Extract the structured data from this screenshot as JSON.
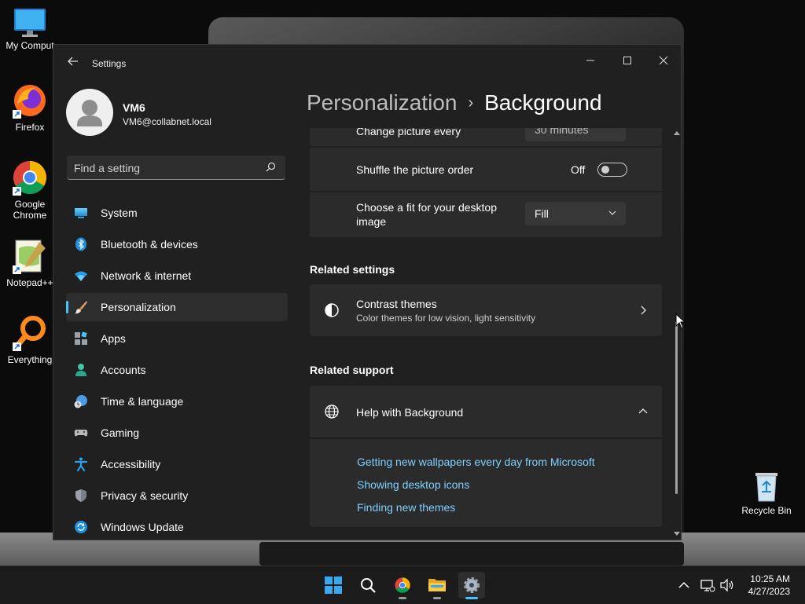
{
  "desktop": {
    "icons": [
      {
        "label": "My Comput"
      },
      {
        "label": "Firefox"
      },
      {
        "label": "Google Chrome"
      },
      {
        "label": "Notepad++"
      },
      {
        "label": "Everything"
      },
      {
        "label": "Recycle Bin"
      }
    ]
  },
  "window": {
    "title": "Settings",
    "back_icon": "arrow-left-icon",
    "controls": [
      "minimize-icon",
      "maximize-icon",
      "close-icon"
    ]
  },
  "profile": {
    "name": "VM6",
    "email": "VM6@collabnet.local"
  },
  "search": {
    "placeholder": "Find a setting"
  },
  "nav": {
    "items": [
      {
        "label": "System",
        "icon": "monitor-icon",
        "active": false
      },
      {
        "label": "Bluetooth & devices",
        "icon": "bluetooth-icon",
        "active": false
      },
      {
        "label": "Network & internet",
        "icon": "wifi-icon",
        "active": false
      },
      {
        "label": "Personalization",
        "icon": "brush-icon",
        "active": true
      },
      {
        "label": "Apps",
        "icon": "apps-icon",
        "active": false
      },
      {
        "label": "Accounts",
        "icon": "person-icon",
        "active": false
      },
      {
        "label": "Time & language",
        "icon": "globe-clock-icon",
        "active": false
      },
      {
        "label": "Gaming",
        "icon": "gamepad-icon",
        "active": false
      },
      {
        "label": "Accessibility",
        "icon": "accessibility-icon",
        "active": false
      },
      {
        "label": "Privacy & security",
        "icon": "shield-icon",
        "active": false
      },
      {
        "label": "Windows Update",
        "icon": "update-icon",
        "active": false
      }
    ]
  },
  "header": {
    "parent": "Personalization",
    "separator": "›",
    "current": "Background"
  },
  "background": {
    "change_picture_label": "Change picture every",
    "change_picture_value": "30 minutes",
    "shuffle_label": "Shuffle the picture order",
    "shuffle_state": "Off",
    "fit_label_line1": "Choose a fit for your desktop",
    "fit_label_line2": "image",
    "fit_value": "Fill"
  },
  "related_settings": {
    "heading": "Related settings",
    "items": [
      {
        "title": "Contrast themes",
        "subtitle": "Color themes for low vision, light sensitivity"
      }
    ]
  },
  "related_support": {
    "heading": "Related support",
    "help_title": "Help with Background",
    "links": [
      "Getting new wallpapers every day from Microsoft",
      "Showing desktop icons",
      "Finding new themes"
    ]
  },
  "taskbar": {
    "apps": [
      "start-icon",
      "search-icon",
      "chrome-icon",
      "file-explorer-icon",
      "settings-icon"
    ],
    "time": "10:25 AM",
    "date": "4/27/2023"
  },
  "colors": {
    "accent": "#4cc2ff",
    "link": "#7fd0ff",
    "window_bg": "#202020",
    "card_bg": "#2b2b2b"
  }
}
